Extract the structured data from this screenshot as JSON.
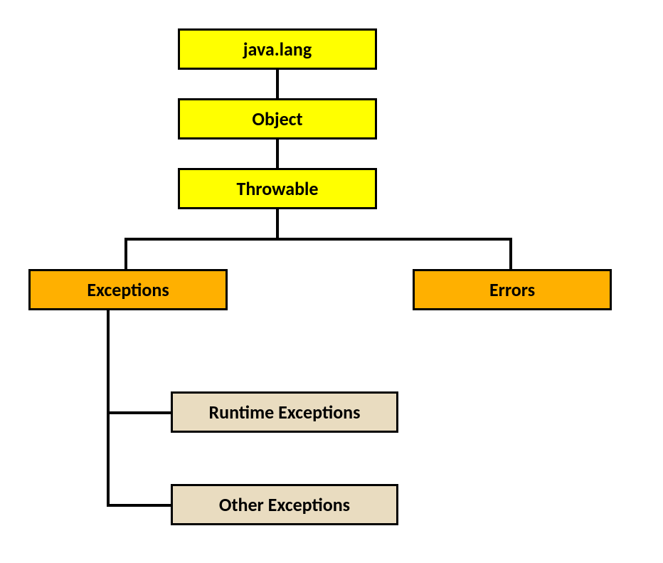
{
  "nodes": {
    "javalang": "java.lang",
    "object": "Object",
    "throwable": "Throwable",
    "exceptions": "Exceptions",
    "errors": "Errors",
    "runtime": "Runtime Exceptions",
    "other": "Other Exceptions"
  }
}
